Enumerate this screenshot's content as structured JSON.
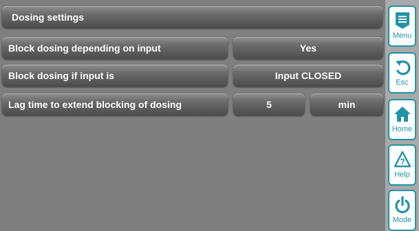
{
  "header": {
    "title": "Dosing settings"
  },
  "rows": [
    {
      "label": "Block dosing depending on input",
      "value": "Yes"
    },
    {
      "label": "Block dosing if input is",
      "value": "Input CLOSED"
    },
    {
      "label": "Lag time to extend blocking of dosing",
      "value": "5",
      "unit": "min"
    }
  ],
  "sidebar": {
    "menu": "Menu",
    "esc": "Esc",
    "home": "Home",
    "help": "Help",
    "mode": "Mode"
  },
  "colors": {
    "accent": "#1f93a5",
    "panel_bg": "#7f7f7f",
    "sidebar_bg": "#a7a9ab"
  },
  "icons": [
    "menu-icon",
    "undo-icon",
    "home-icon",
    "help-icon",
    "power-icon"
  ]
}
